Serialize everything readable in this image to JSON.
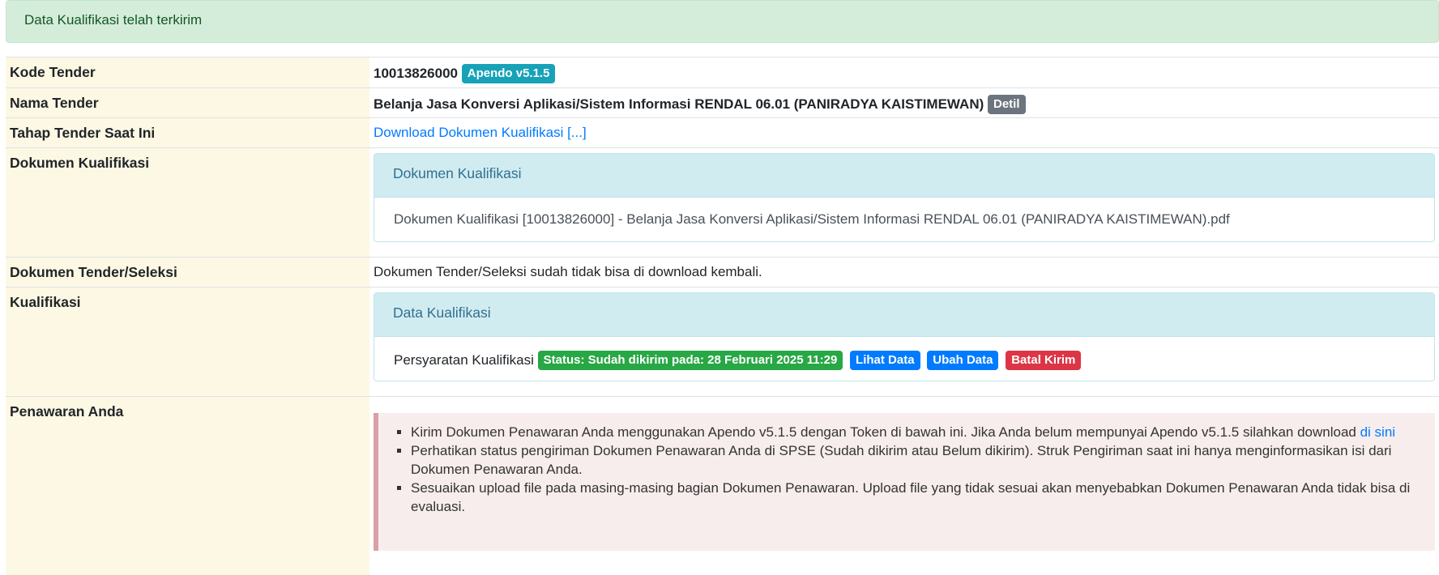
{
  "alert": {
    "message": "Data Kualifikasi telah terkirim"
  },
  "rows": {
    "kode_tender": {
      "label": "Kode Tender",
      "value": "10013826000",
      "badge": "Apendo v5.1.5"
    },
    "nama_tender": {
      "label": "Nama Tender",
      "value": "Belanja Jasa Konversi Aplikasi/Sistem Informasi RENDAL 06.01 (PANIRADYA KAISTIMEWAN)",
      "badge": "Detil"
    },
    "tahap": {
      "label": "Tahap Tender Saat Ini",
      "link": "Download Dokumen Kualifikasi [...]"
    },
    "dok_kualifikasi": {
      "label": "Dokumen Kualifikasi",
      "card_title": "Dokumen Kualifikasi",
      "file": "Dokumen Kualifikasi [10013826000] - Belanja Jasa Konversi Aplikasi/Sistem Informasi RENDAL 06.01 (PANIRADYA KAISTIMEWAN).pdf"
    },
    "dok_tender": {
      "label": "Dokumen Tender/Seleksi",
      "value": "Dokumen Tender/Seleksi sudah tidak bisa di download kembali."
    },
    "kualifikasi": {
      "label": "Kualifikasi",
      "card_title": "Data Kualifikasi",
      "item": "Persyaratan Kualifikasi",
      "status": "Status: Sudah dikirim pada: 28 Februari 2025 11:29",
      "btn_lihat": "Lihat Data",
      "btn_ubah": "Ubah Data",
      "btn_batal": "Batal Kirim"
    },
    "penawaran": {
      "label": "Penawaran Anda",
      "items": [
        {
          "text": "Kirim Dokumen Penawaran Anda menggunakan Apendo v5.1.5 dengan Token di bawah ini. Jika Anda belum mempunyai Apendo v5.1.5 silahkan download ",
          "link": "di sini"
        },
        {
          "text": "Perhatikan status pengiriman Dokumen Penawaran Anda di SPSE (Sudah dikirim atau Belum dikirim). Struk Pengiriman saat ini hanya menginformasikan isi dari Dokumen Penawaran Anda."
        },
        {
          "text": "Sesuaikan upload file pada masing-masing bagian Dokumen Penawaran. Upload file yang tidak sesuai akan menyebabkan Dokumen Penawaran Anda tidak bisa di evaluasi."
        }
      ]
    }
  },
  "colors": {
    "success_bg": "#d4edda",
    "label_bg": "#fcf8e3",
    "info_badge": "#17a2b8",
    "primary": "#007bff",
    "danger": "#dc3545"
  }
}
